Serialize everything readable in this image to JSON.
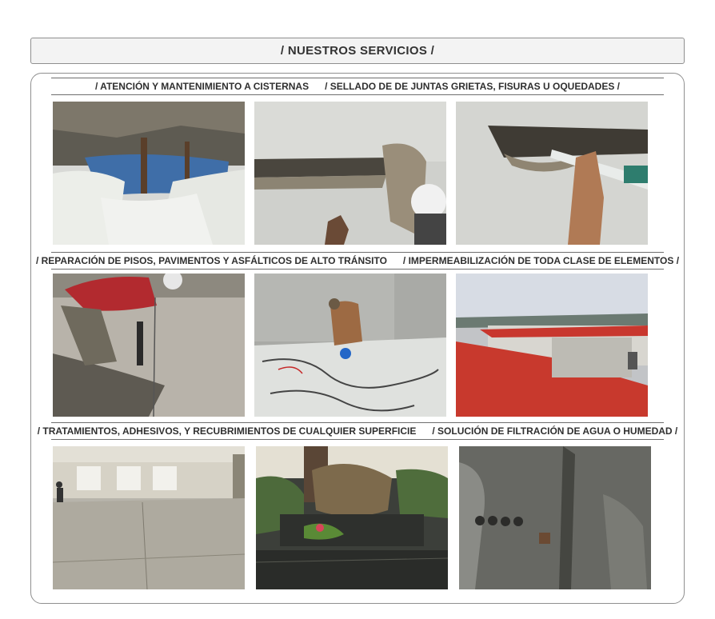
{
  "header": {
    "title": "/ NUESTROS SERVICIOS  /"
  },
  "captions": [
    {
      "left": "/ ATENCIÓN Y MANTENIMIENTO A CISTERNAS",
      "right": "/  SELLADO DE DE JUNTAS GRIETAS, FISURAS U OQUEDADES  /"
    },
    {
      "left": "/ REPARACIÓN DE PISOS, PAVIMENTOS Y ASFÁLTICOS DE ALTO TRÁNSITO",
      "right": "/  IMPERMEABILIZACIÓN DE TODA CLASE DE ELEMENTOS  /"
    },
    {
      "left": "/ TRATAMIENTOS, ADHESIVOS, Y RECUBRIMIENTOS DE CUALQUIER SUPERFICIE",
      "right": "/  SOLUCIÓN DE FILTRACIÓN DE AGUA  O HUMEDAD  /"
    }
  ]
}
